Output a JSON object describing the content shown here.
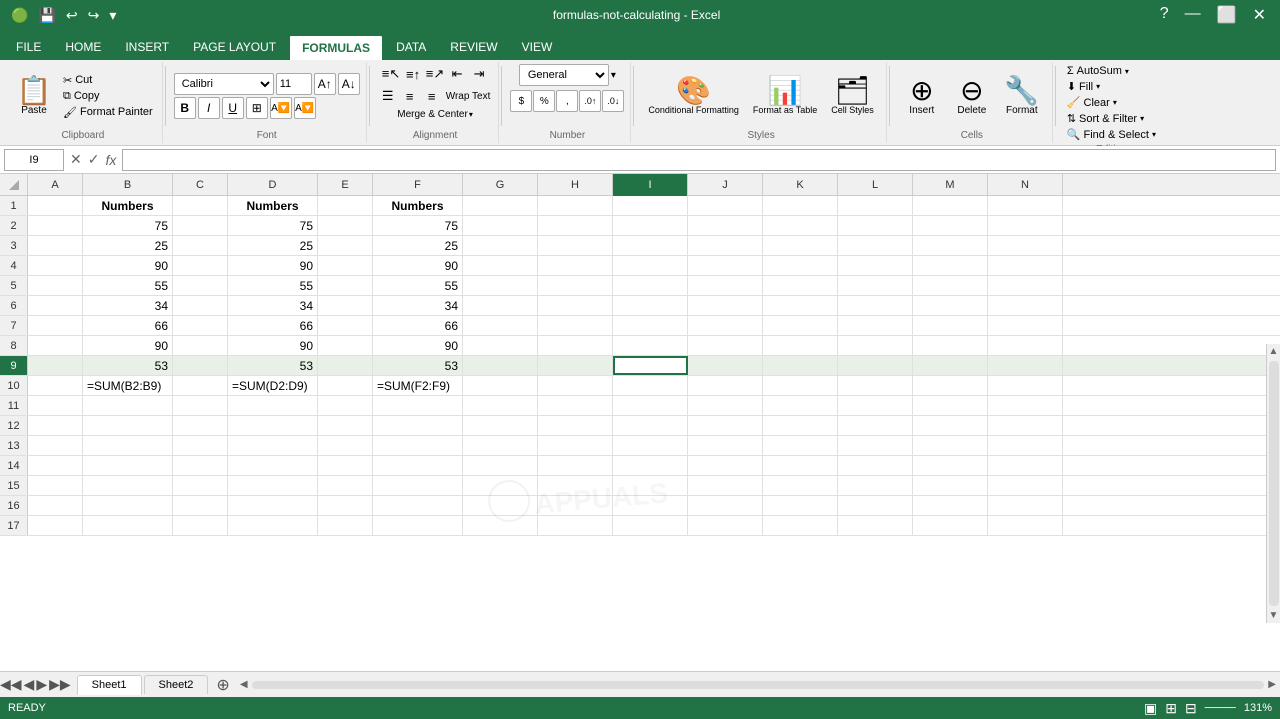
{
  "titleBar": {
    "title": "formulas-not-calculating - Excel",
    "leftIcons": [
      "💾",
      "↩",
      "↪",
      "▼"
    ],
    "ctrlBtns": [
      "?",
      "—",
      "⬜",
      "✕"
    ]
  },
  "ribbonTabs": [
    {
      "id": "file",
      "label": "FILE",
      "active": false
    },
    {
      "id": "home",
      "label": "HOME",
      "active": false
    },
    {
      "id": "insert",
      "label": "INSERT",
      "active": false
    },
    {
      "id": "pageLayout",
      "label": "PAGE LAYOUT",
      "active": false
    },
    {
      "id": "formulas",
      "label": "FORMULAS",
      "active": true
    },
    {
      "id": "data",
      "label": "DATA",
      "active": false
    },
    {
      "id": "review",
      "label": "REVIEW",
      "active": false
    },
    {
      "id": "view",
      "label": "VIEW",
      "active": false
    }
  ],
  "ribbon": {
    "clipboard": {
      "label": "Clipboard",
      "pasteLabel": "Paste",
      "cutLabel": "Cut",
      "copyLabel": "Copy",
      "formatLabel": "Format Painter"
    },
    "font": {
      "label": "Font",
      "family": "Calibri",
      "size": "11",
      "bold": "B",
      "italic": "I",
      "underline": "U"
    },
    "alignment": {
      "label": "Alignment",
      "wrapText": "Wrap Text",
      "mergeCenter": "Merge & Center"
    },
    "number": {
      "label": "Number",
      "format": "General"
    },
    "styles": {
      "label": "Styles",
      "condFormatting": "Conditional Formatting",
      "formatAsTable": "Format as Table",
      "cellStyles": "Cell Styles"
    },
    "cells": {
      "label": "Cells",
      "insert": "Insert",
      "delete": "Delete",
      "format": "Format"
    },
    "editing": {
      "label": "Editing",
      "autoSum": "AutoSum",
      "fill": "Fill",
      "clear": "Clear",
      "sortFilter": "Sort & Filter",
      "findSelect": "Find & Select"
    }
  },
  "formulaBar": {
    "cellRef": "I9",
    "fxLabel": "fx"
  },
  "columns": [
    "A",
    "B",
    "C",
    "D",
    "E",
    "F",
    "G",
    "H",
    "I",
    "J",
    "K",
    "L",
    "M",
    "N"
  ],
  "selectedColumn": "I",
  "selectedRow": 9,
  "rows": [
    {
      "num": 1,
      "cells": {
        "B": "Numbers",
        "D": "Numbers",
        "F": "Numbers"
      }
    },
    {
      "num": 2,
      "cells": {
        "B": "75",
        "D": "75",
        "F": "75"
      }
    },
    {
      "num": 3,
      "cells": {
        "B": "25",
        "D": "25",
        "F": "25"
      }
    },
    {
      "num": 4,
      "cells": {
        "B": "90",
        "D": "90",
        "F": "90"
      }
    },
    {
      "num": 5,
      "cells": {
        "B": "55",
        "D": "55",
        "F": "55"
      }
    },
    {
      "num": 6,
      "cells": {
        "B": "34",
        "D": "34",
        "F": "34"
      }
    },
    {
      "num": 7,
      "cells": {
        "B": "66",
        "D": "66",
        "F": "66"
      }
    },
    {
      "num": 8,
      "cells": {
        "B": "90",
        "D": "90",
        "F": "90"
      }
    },
    {
      "num": 9,
      "cells": {
        "B": "53",
        "D": "53",
        "F": "53"
      }
    },
    {
      "num": 10,
      "cells": {
        "B": "=SUM(B2:B9)",
        "D": "=SUM(D2:D9)",
        "F": "=SUM(F2:F9)"
      }
    },
    {
      "num": 11,
      "cells": {}
    },
    {
      "num": 12,
      "cells": {}
    },
    {
      "num": 13,
      "cells": {}
    },
    {
      "num": 14,
      "cells": {}
    },
    {
      "num": 15,
      "cells": {}
    },
    {
      "num": 16,
      "cells": {}
    },
    {
      "num": 17,
      "cells": {}
    }
  ],
  "sheetTabs": [
    {
      "id": "sheet1",
      "label": "Sheet1",
      "active": true
    },
    {
      "id": "sheet2",
      "label": "Sheet2",
      "active": false
    }
  ],
  "statusBar": {
    "left": "READY",
    "zoomLevel": "131%"
  },
  "watermark": "appuals"
}
